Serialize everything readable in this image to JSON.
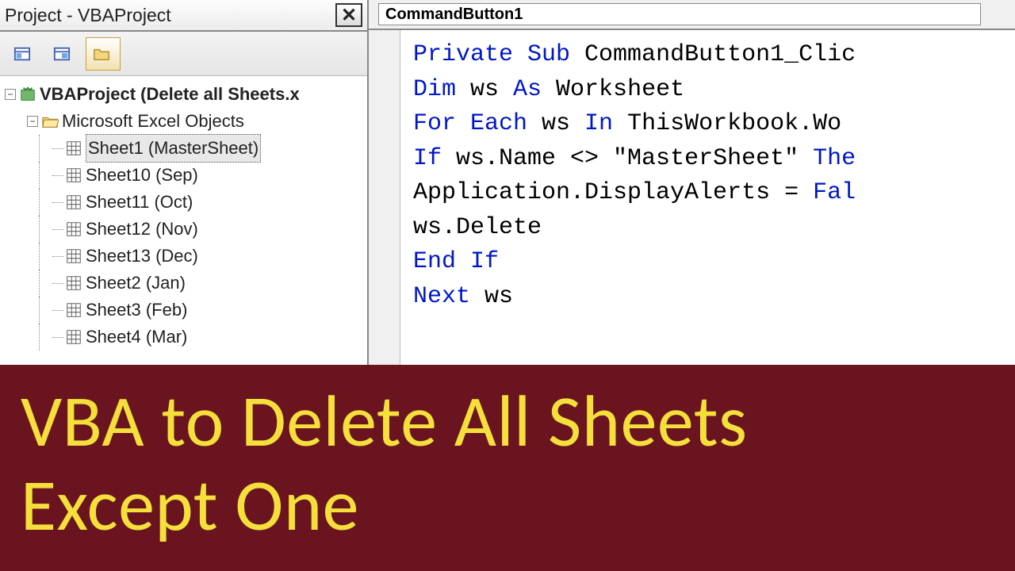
{
  "left_panel": {
    "title": "Project - VBAProject",
    "toolbar": {
      "btn1": "view-code-icon",
      "btn2": "view-object-icon",
      "btn3": "folder-icon"
    },
    "tree": {
      "root": "VBAProject (Delete all Sheets.x",
      "folder": "Microsoft Excel Objects",
      "sheets": [
        "Sheet1 (MasterSheet)",
        "Sheet10 (Sep)",
        "Sheet11 (Oct)",
        "Sheet12 (Nov)",
        "Sheet13 (Dec)",
        "Sheet2 (Jan)",
        "Sheet3 (Feb)",
        "Sheet4 (Mar)"
      ]
    }
  },
  "right_panel": {
    "dropdown": "CommandButton1",
    "code_lines": [
      [
        {
          "t": "Private Sub",
          "k": true
        },
        {
          "t": " CommandButton1_Clic",
          "k": false
        }
      ],
      [
        {
          "t": "Dim",
          "k": true
        },
        {
          "t": " ws ",
          "k": false
        },
        {
          "t": "As",
          "k": true
        },
        {
          "t": " Worksheet",
          "k": false
        }
      ],
      [
        {
          "t": "For Each",
          "k": true
        },
        {
          "t": " ws ",
          "k": false
        },
        {
          "t": "In",
          "k": true
        },
        {
          "t": " ThisWorkbook.Wo",
          "k": false
        }
      ],
      [
        {
          "t": "If",
          "k": true
        },
        {
          "t": " ws.Name <> \"MasterSheet\" ",
          "k": false
        },
        {
          "t": "The",
          "k": true
        }
      ],
      [
        {
          "t": "Application.DisplayAlerts = ",
          "k": false
        },
        {
          "t": "Fal",
          "k": true
        }
      ],
      [
        {
          "t": "ws.Delete",
          "k": false
        }
      ],
      [
        {
          "t": "End If",
          "k": true
        }
      ],
      [
        {
          "t": "Next",
          "k": true
        },
        {
          "t": " ws",
          "k": false
        }
      ]
    ]
  },
  "banner": {
    "line1": "VBA to Delete All Sheets",
    "line2": "Except One"
  }
}
